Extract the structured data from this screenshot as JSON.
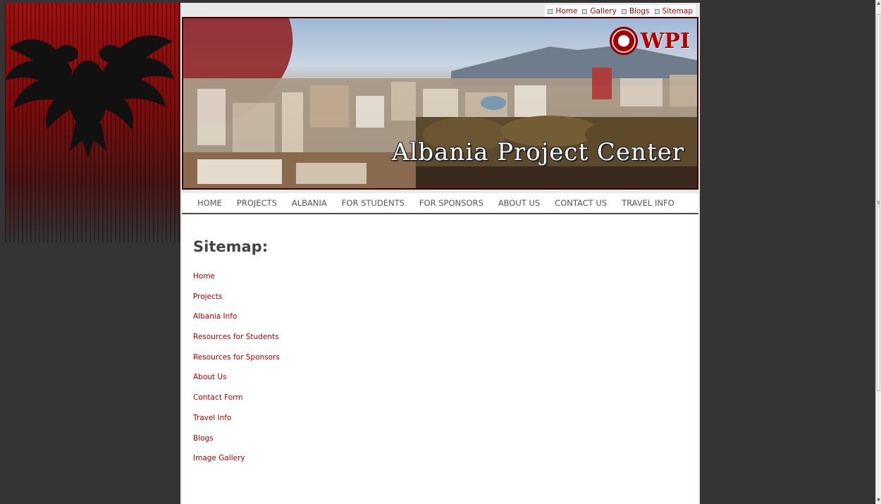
{
  "top_links": [
    {
      "label": "Home"
    },
    {
      "label": "Gallery"
    },
    {
      "label": "Blogs"
    },
    {
      "label": "Sitemap"
    }
  ],
  "banner": {
    "title": "Albania Project Center",
    "logo_text": "WPI"
  },
  "nav": {
    "items": [
      {
        "label": "HOME"
      },
      {
        "label": "PROJECTS"
      },
      {
        "label": "ALBANIA"
      },
      {
        "label": "FOR STUDENTS"
      },
      {
        "label": "FOR SPONSORS"
      },
      {
        "label": "ABOUT US"
      },
      {
        "label": "CONTACT US"
      },
      {
        "label": "TRAVEL INFO"
      }
    ]
  },
  "content": {
    "title": "Sitemap:",
    "links": [
      {
        "label": "Home"
      },
      {
        "label": "Projects"
      },
      {
        "label": "Albania Info"
      },
      {
        "label": "Resources for Students"
      },
      {
        "label": "Resources for Sponsors"
      },
      {
        "label": "About Us"
      },
      {
        "label": "Contact Form"
      },
      {
        "label": "Travel Info"
      },
      {
        "label": "Blogs"
      },
      {
        "label": "Image Gallery"
      }
    ]
  },
  "colors": {
    "background": "#343434",
    "link": "#b00000",
    "flag_red": "#a01010",
    "nav_text": "#555555"
  }
}
